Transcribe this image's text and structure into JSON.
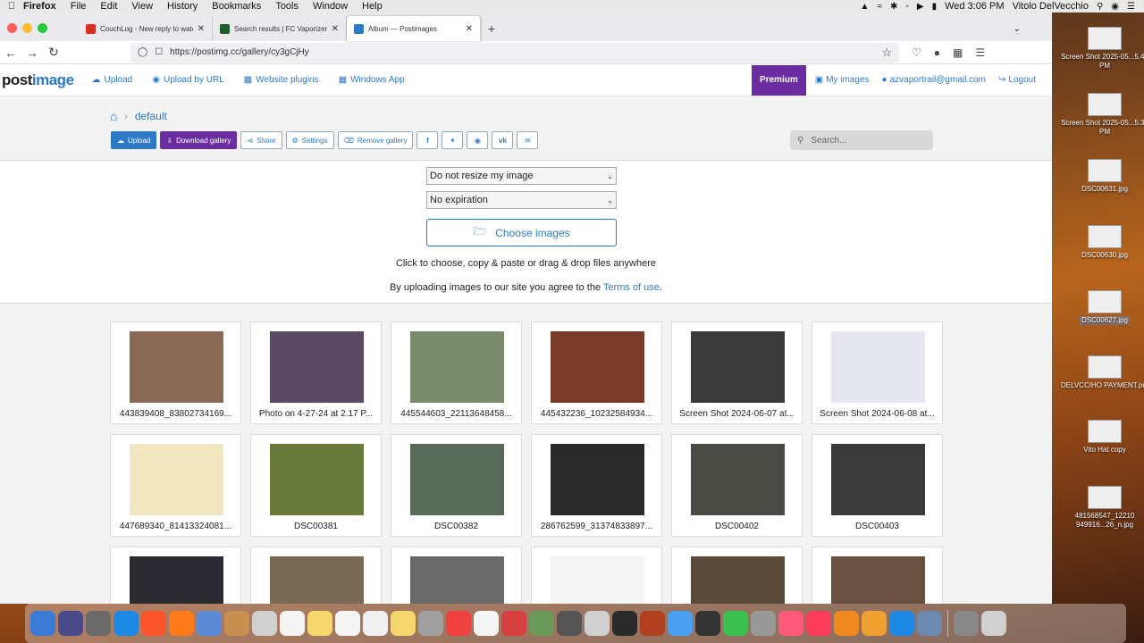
{
  "menubar": {
    "app": "Firefox",
    "items": [
      "File",
      "Edit",
      "View",
      "History",
      "Bookmarks",
      "Tools",
      "Window",
      "Help"
    ],
    "clock": "Wed 3:06 PM",
    "user": "Vitolo DelVecchio"
  },
  "tabs": [
    {
      "title": "CouchLog - New reply to watch",
      "color": "#d93025",
      "glyph": "M"
    },
    {
      "title": "Search results | FC Vaporizer Re",
      "color": "#1e5e2a",
      "glyph": "F"
    },
    {
      "title": "Album — Postimages",
      "color": "#2d79c6",
      "glyph": "P",
      "active": true
    }
  ],
  "url": "https://postimg.cc/gallery/cy3gCjHy",
  "site": {
    "logo_a": "post",
    "logo_b": "image",
    "nav": [
      "Upload",
      "Upload by URL",
      "Website plugins",
      "Windows App"
    ],
    "premium": "Premium",
    "my_images": "My images",
    "email": "azvaportrail@gmail.com",
    "logout": "Logout"
  },
  "gallery": {
    "crumb": "default",
    "buttons": {
      "upload": "Upload",
      "download": "Download gallery",
      "share": "Share",
      "settings": "Settings",
      "remove": "Remove gallery"
    },
    "search_placeholder": "Search..."
  },
  "upload": {
    "resize": "Do not resize my image",
    "expiration": "No expiration",
    "choose": "Choose images",
    "hint": "Click to choose, copy & paste or drag & drop files anywhere",
    "terms_prefix": "By uploading images to our site you agree to the ",
    "terms_link": "Terms of use",
    "terms_suffix": "."
  },
  "images": [
    {
      "caption": "443839408_83802734169...",
      "color": "#8a6a55"
    },
    {
      "caption": "Photo on 4-27-24 at 2.17 P...",
      "color": "#5a4a66"
    },
    {
      "caption": "445544603_22113648458...",
      "color": "#7a8a6a"
    },
    {
      "caption": "445432236_10232584934...",
      "color": "#7a3a2a"
    },
    {
      "caption": "Screen Shot 2024-06-07 at...",
      "color": "#3a3a3a"
    },
    {
      "caption": "Screen Shot 2024-06-08 at...",
      "color": "#e6e6ee"
    },
    {
      "caption": "447689340_81413324081...",
      "color": "#f0e6c0"
    },
    {
      "caption": "DSC00381",
      "color": "#6a7a3a"
    },
    {
      "caption": "DSC00382",
      "color": "#5a6a5a"
    },
    {
      "caption": "286762599_31374833897...",
      "color": "#2a2a2a"
    },
    {
      "caption": "DSC00402",
      "color": "#4a4a44"
    },
    {
      "caption": "DSC00403",
      "color": "#3a3a3a"
    },
    {
      "caption": "",
      "color": "#2a2a30"
    },
    {
      "caption": "",
      "color": "#7a6a55"
    },
    {
      "caption": "",
      "color": "#6a6a6a"
    },
    {
      "caption": "",
      "color": "#f4f4f4"
    },
    {
      "caption": "",
      "color": "#5a4a3a"
    },
    {
      "caption": "",
      "color": "#6a5040"
    }
  ],
  "desktop": [
    {
      "name": "Screen Shot 2025-05...5.49 PM"
    },
    {
      "name": "Screen Shot 2025-05...5.34 PM"
    },
    {
      "name": "DSC00631.jpg"
    },
    {
      "name": "DSC00630.jpg"
    },
    {
      "name": "DSC00627.jpg"
    },
    {
      "name": "DELVCCIHO PAYMENT.pdf"
    },
    {
      "name": "Vito Hat copy"
    },
    {
      "name": "481568547_12210 949916...26_n.jpg"
    }
  ],
  "dock_colors": [
    "#3a7bd5",
    "#4a4a8a",
    "#6a6a6a",
    "#1e88e5",
    "#fb542b",
    "#ff7a1a",
    "#5a8ad5",
    "#c89050",
    "#d0d0d0",
    "#f5f5f5",
    "#f5d76e",
    "#f5f5f5",
    "#f0f0f0",
    "#f5d76e",
    "#a0a0a0",
    "#f04040",
    "#f5f5f5",
    "#d84040",
    "#6a9a5a",
    "#555555",
    "#d0d0d0",
    "#2a2a2a",
    "#b04020",
    "#4aa0f0",
    "#333333",
    "#3ac050",
    "#999999",
    "#ff5a7a",
    "#fa3c5a",
    "#f08a20",
    "#f0a030",
    "#1e88e5",
    "#6a8ab0",
    "#888888",
    "#d0d0d0"
  ]
}
